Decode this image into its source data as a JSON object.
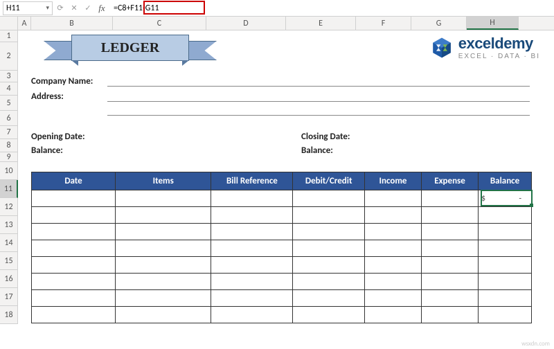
{
  "nameBox": "H11",
  "formula": "=C8+F11-G11",
  "columns": [
    "A",
    "B",
    "C",
    "D",
    "E",
    "F",
    "G",
    "H"
  ],
  "rows": [
    "1",
    "2",
    "3",
    "4",
    "5",
    "6",
    "7",
    "8",
    "9",
    "10",
    "11",
    "12",
    "13",
    "14",
    "15",
    "16",
    "17",
    "18"
  ],
  "banner": "LEDGER",
  "brand": {
    "name": "exceldemy",
    "sub": "EXCEL · DATA · BI"
  },
  "labels": {
    "company": "Company Name:",
    "address": "Address:",
    "openingDate": "Opening Date:",
    "openingBal": "Balance:",
    "closingDate": "Closing Date:",
    "closingBal": "Balance:"
  },
  "table": {
    "headers": [
      "Date",
      "Items",
      "Bill Reference",
      "Debit/Credit",
      "Income",
      "Expense",
      "Balance"
    ],
    "firstBalance": {
      "currency": "$",
      "value": "-"
    }
  },
  "watermark": "wsxdn.com"
}
